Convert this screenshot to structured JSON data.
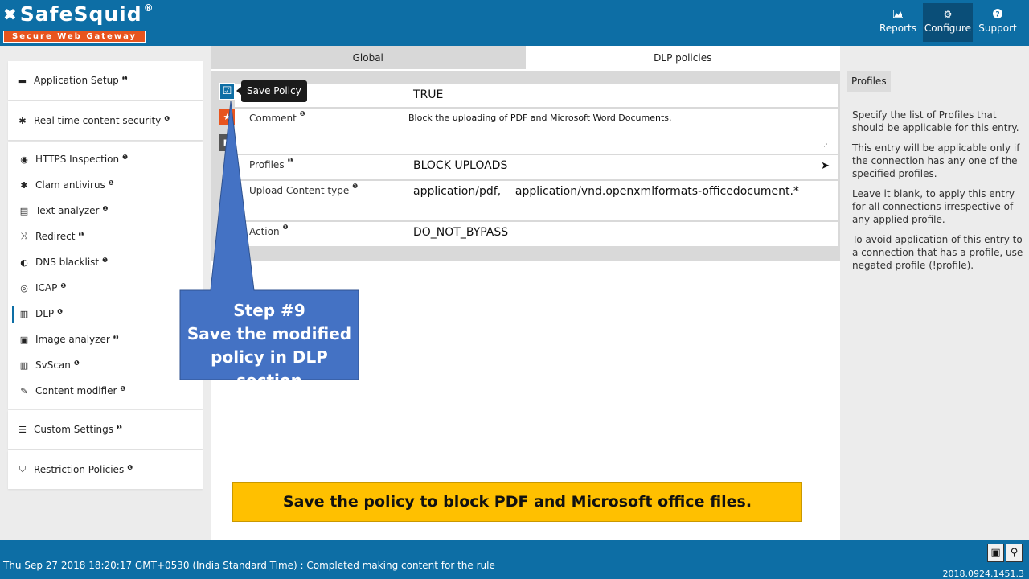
{
  "header": {
    "logo_text": "SafeSquid",
    "logo_reg": "®",
    "tagline": "Secure Web Gateway",
    "nav": [
      {
        "label": "Reports",
        "icon": "area-chart-icon"
      },
      {
        "label": "Configure",
        "icon": "gears-icon"
      },
      {
        "label": "Support",
        "icon": "question-icon"
      }
    ]
  },
  "sidebar": {
    "application_setup": "Application Setup",
    "real_time_content_security": "Real time content security",
    "items": [
      {
        "label": "HTTPS Inspection",
        "icon": "eye-icon"
      },
      {
        "label": "Clam antivirus",
        "icon": "asterisk-icon"
      },
      {
        "label": "Text analyzer",
        "icon": "file-text-icon"
      },
      {
        "label": "Redirect",
        "icon": "random-icon"
      },
      {
        "label": "DNS blacklist",
        "icon": "contrast-icon"
      },
      {
        "label": "ICAP",
        "icon": "life-ring-icon"
      },
      {
        "label": "DLP",
        "icon": "barcode-icon"
      },
      {
        "label": "Image analyzer",
        "icon": "file-image-icon"
      },
      {
        "label": "SvScan",
        "icon": "barcode-icon"
      },
      {
        "label": "Content modifier",
        "icon": "edit-icon"
      }
    ],
    "custom_settings": "Custom Settings",
    "restriction_policies": "Restriction Policies",
    "info_mark": "❶"
  },
  "tabs": {
    "global": "Global",
    "dlp": "DLP policies"
  },
  "tooltip": "Save Policy",
  "form": {
    "enabled_value": "TRUE",
    "comment_label": "Comment",
    "comment_value": "Block the uploading of PDF and Microsoft Word Documents.",
    "profiles_label": "Profiles",
    "profiles_value": "BLOCK UPLOADS",
    "upload_content_type_label": "Upload Content type",
    "upload_content_type_value": "application/pdf,    application/vnd.openxmlformats-officedocument.*",
    "action_label": "Action",
    "action_value": "DO_NOT_BYPASS"
  },
  "callout": {
    "line1": "Step #9",
    "line2": "Save the modified",
    "line3": "policy in DLP section"
  },
  "banner": "Save the policy to block PDF and Microsoft office files.",
  "right_panel": {
    "title": "Profiles",
    "p1": "Specify the list of Profiles that should be applicable for this entry.",
    "p2": "This entry will be applicable only if the connection has any one of the specified profiles.",
    "p3": "Leave it blank, to apply this entry for all connections irrespective of any applied profile.",
    "p4": "To avoid application of this entry to a connection that has a profile, use negated profile (!profile)."
  },
  "footer": {
    "status": "Thu Sep 27 2018 18:20:17 GMT+0530 (India Standard Time) : Completed making content for the rule",
    "version": "2018.0924.1451.3"
  },
  "colors": {
    "brand_blue": "#0d6ea5",
    "brand_orange": "#e8541e",
    "callout_blue": "#4472c4",
    "banner_yellow": "#ffc000"
  }
}
